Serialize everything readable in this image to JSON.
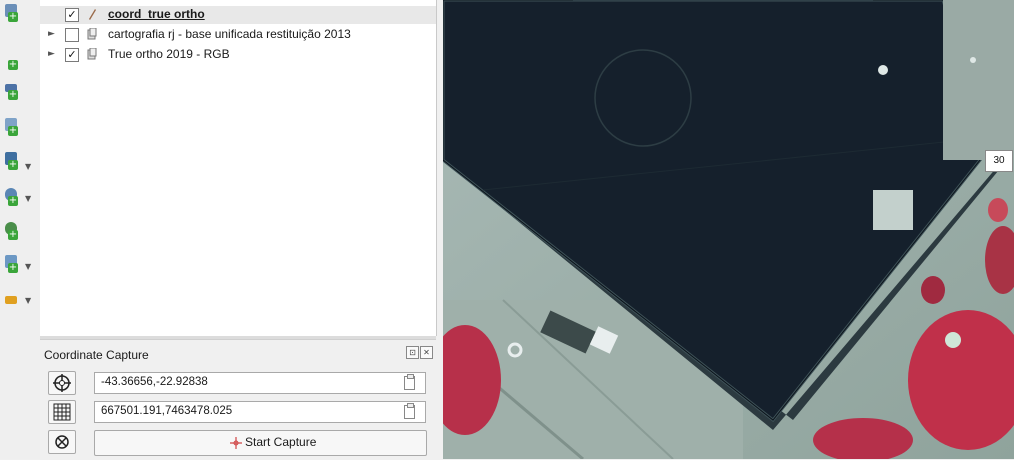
{
  "layers": [
    {
      "name": "coord_true ortho",
      "checked": "✓",
      "bold": true,
      "icon": "vector-layer-icon"
    },
    {
      "name": "cartografia rj - base unificada restituição 2013",
      "checked": "",
      "bold": false,
      "icon": "group-layer-icon"
    },
    {
      "name": "True ortho 2019 - RGB",
      "checked": "✓",
      "bold": false,
      "icon": "raster-layer-icon"
    }
  ],
  "coordinate_capture": {
    "title": "Coordinate Capture",
    "geographic_value": "-43.36656,-22.92838",
    "projected_value": "667501.191,7463478.025",
    "start_label": "Start Capture"
  },
  "map": {
    "point_label": "30"
  },
  "colors": {
    "panel_bg": "#f0f0f0",
    "selected_row": "#e8e8e8",
    "roof": "#15202c",
    "vegetation": "#c0304a"
  }
}
